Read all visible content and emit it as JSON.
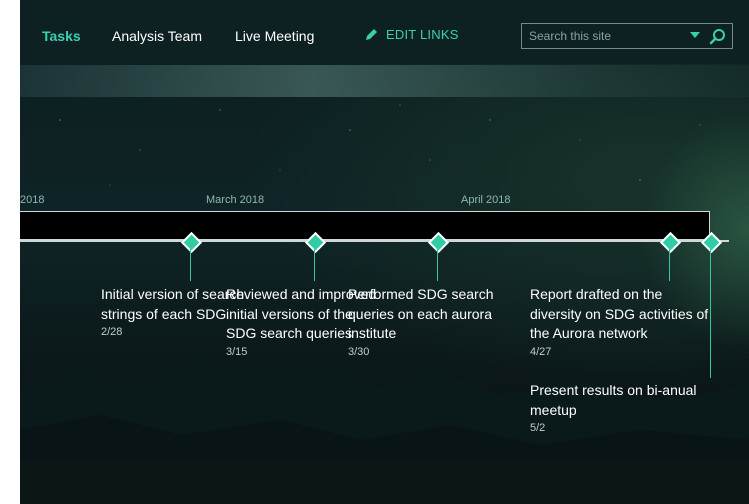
{
  "nav": {
    "items": [
      {
        "label": "Tasks",
        "active": true
      },
      {
        "label": "Analysis Team",
        "active": false
      },
      {
        "label": "Live Meeting",
        "active": false
      }
    ],
    "edit_links": "EDIT LINKS",
    "edit_icon": "pencil-icon",
    "search_placeholder": "Search this site",
    "search_icon": "magnifier-icon",
    "dropdown_icon": "caret-down-icon"
  },
  "timeline": {
    "months": [
      "2018",
      "March 2018",
      "April 2018"
    ],
    "tasks": [
      {
        "title": "Initial version of search strings of each SDG",
        "date": "2/28"
      },
      {
        "title": "Reviewed and improved initial versions of the SDG search queries",
        "date": "3/15"
      },
      {
        "title": "Performed SDG search queries on each aurora institute",
        "date": "3/30"
      },
      {
        "title": "Report drafted on the diversity on SDG activities of the Aurora network",
        "date": "4/27"
      },
      {
        "title": "Present results on bi-anual meetup",
        "date": "5/2"
      }
    ]
  },
  "colors": {
    "accent": "#3ad0ae",
    "bar": "#000000",
    "nav_bg": "#0d2123"
  }
}
